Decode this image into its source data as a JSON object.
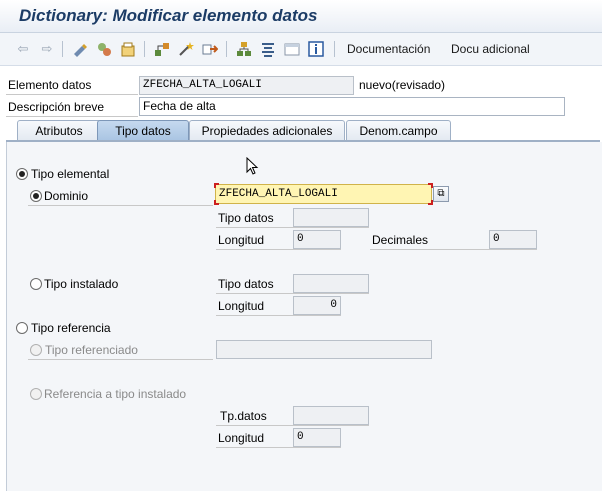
{
  "window": {
    "title": "Dictionary: Modificar elemento datos"
  },
  "toolbar": {
    "icons": [
      "back-arrow-icon",
      "forward-arrow-icon",
      "display-change-icon",
      "other-object-icon",
      "activate-icon",
      "where-used-icon",
      "magic-wand-icon",
      "navigate-icon",
      "hierarchy-icon",
      "align-icon",
      "layout-icon",
      "info-icon"
    ],
    "documentacion_label": "Documentación",
    "docu_adicional_label": "Docu adicional"
  },
  "header": {
    "elemento_label": "Elemento datos",
    "elemento_value": "ZFECHA_ALTA_LOGALI",
    "status": "nuevo(revisado)",
    "descripcion_label": "Descripción breve",
    "descripcion_value": "Fecha de alta"
  },
  "tabs": [
    {
      "label": "Atributos",
      "active": false
    },
    {
      "label": "Tipo datos",
      "active": true
    },
    {
      "label": "Propiedades adicionales",
      "active": false
    },
    {
      "label": "Denom.campo",
      "active": false
    }
  ],
  "tipo_elemental": {
    "label": "Tipo elemental",
    "dominio_label": "Dominio",
    "dominio_value": "ZFECHA_ALTA_LOGALI",
    "tipo_datos_label": "Tipo datos",
    "tipo_datos_value": "",
    "longitud_label": "Longitud",
    "longitud_value": "0",
    "decimales_label": "Decimales",
    "decimales_value": "0"
  },
  "tipo_instalado": {
    "label": "Tipo instalado",
    "tipo_datos_label": "Tipo datos",
    "tipo_datos_value": "",
    "longitud_label": "Longitud",
    "longitud_value": "0"
  },
  "tipo_referencia": {
    "label": "Tipo referencia",
    "referenciado_label": "Tipo referenciado",
    "referenciado_value": "",
    "ref_instalado_label": "Referencia a tipo instalado",
    "tpdatos_label": "Tp.datos",
    "tpdatos_value": "",
    "longitud_label": "Longitud",
    "longitud_value": "0"
  },
  "colors": {
    "title": "#1c3c66",
    "active_tab": "#a9c4e2",
    "focus_field": "#fff5b3",
    "focus_corner": "#cc1f1f"
  }
}
